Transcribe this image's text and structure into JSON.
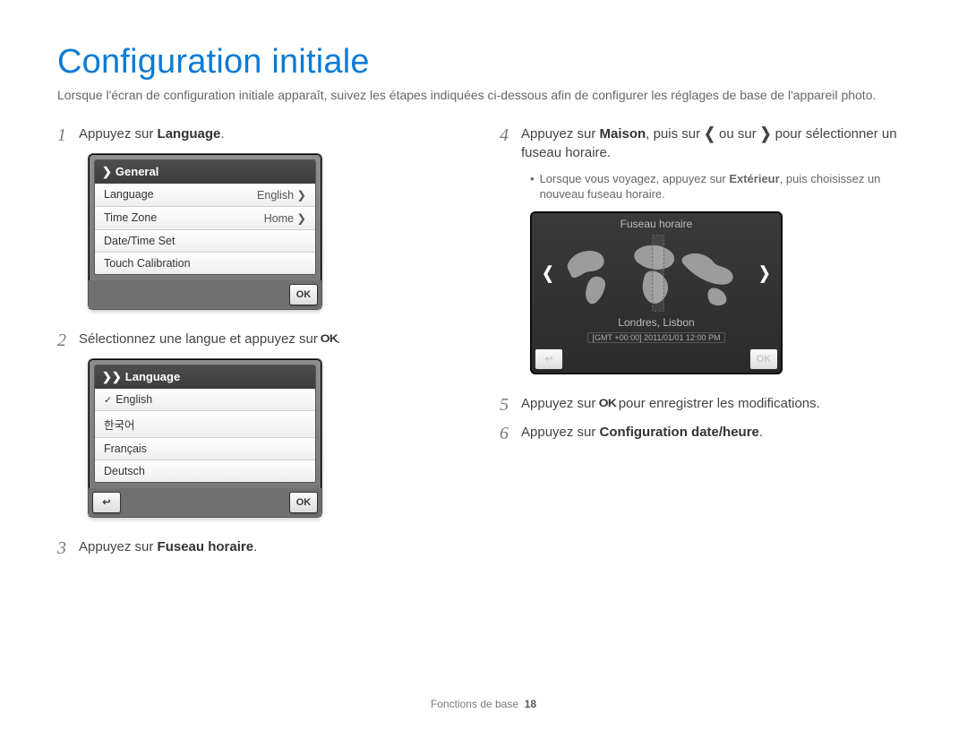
{
  "title": "Configuration initiale",
  "intro": "Lorsque l'écran de configuration initiale apparaît, suivez les étapes indiquées ci-dessous afin de configurer les réglages de base de l'appareil photo.",
  "steps": {
    "s1": {
      "num": "1",
      "pre": "Appuyez sur ",
      "bold": "Language",
      "post": "."
    },
    "s2": {
      "num": "2",
      "pre": "Sélectionnez une langue et appuyez sur ",
      "post": "."
    },
    "s3": {
      "num": "3",
      "pre": "Appuyez sur ",
      "bold": "Fuseau horaire",
      "post": "."
    },
    "s4": {
      "num": "4",
      "pre": "Appuyez sur ",
      "bold1": "Maison",
      "mid1": ", puis sur ",
      "mid2": " ou sur ",
      "post": " pour sélectionner un fuseau horaire."
    },
    "s4_sub": {
      "pre": "Lorsque vous voyagez, appuyez sur ",
      "bold": "Extérieur",
      "post": ", puis choisissez un nouveau fuseau horaire."
    },
    "s5": {
      "num": "5",
      "pre": "Appuyez sur ",
      "post": " pour enregistrer les modifications."
    },
    "s6": {
      "num": "6",
      "pre": "Appuyez sur ",
      "bold": "Configuration date/heure",
      "post": "."
    }
  },
  "mock_general": {
    "header": "General",
    "rows": [
      {
        "label": "Language",
        "value": "English"
      },
      {
        "label": "Time Zone",
        "value": "Home"
      },
      {
        "label": "Date/Time Set",
        "value": ""
      },
      {
        "label": "Touch Calibration",
        "value": ""
      }
    ],
    "ok": "OK"
  },
  "mock_language": {
    "header": "Language",
    "items": [
      "English",
      "한국어",
      "Français",
      "Deutsch"
    ],
    "ok": "OK"
  },
  "mock_world": {
    "title": "Fuseau horaire",
    "city": "Londres, Lisbon",
    "stamp": "[GMT +00:00]  2011/01/01  12:00 PM",
    "ok": "OK"
  },
  "ok_glyph": "OK",
  "footer": {
    "section": "Fonctions de base",
    "page": "18"
  }
}
